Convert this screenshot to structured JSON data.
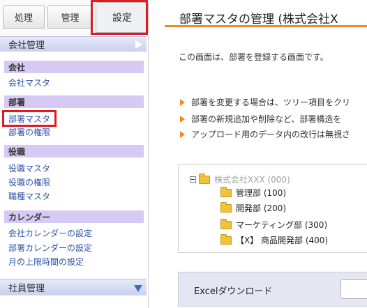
{
  "tabs": [
    {
      "label": "処理"
    },
    {
      "label": "管理"
    },
    {
      "label": "設定"
    }
  ],
  "sidebar": {
    "company_header": "会社管理",
    "employee_header": "社員管理",
    "sections": [
      {
        "label": "会社",
        "links": [
          "会社マスタ"
        ]
      },
      {
        "label": "部署",
        "links": [
          "部署マスタ",
          "部署の権限"
        ]
      },
      {
        "label": "役職",
        "links": [
          "役職マスタ",
          "役職の権限",
          "職種マスタ"
        ]
      },
      {
        "label": "カレンダー",
        "links": [
          "会社カレンダーの設定",
          "部署カレンダーの設定",
          "月の上限時間の設定"
        ]
      }
    ]
  },
  "main": {
    "title": "部署マスタの管理 (株式会社X",
    "description": "この画面は、部署を登録する画面です。",
    "notes": [
      "部署を変更する場合は、ツリー項目をクリ",
      "部署の新規追加や削除など、部署構造を",
      "アップロード用のデータ内の改行は無視さ"
    ],
    "tree": {
      "root": "株式会社XXX (000)",
      "children": [
        "管理部 (100)",
        "開発部 (200)",
        "マーケティング部 (300)",
        "【X】 商品開発部 (400)"
      ]
    },
    "excel_download_label": "Excelダウンロード"
  },
  "colors": {
    "accent_orange": "#f08a1c",
    "highlight_red": "#e01b24",
    "section_purple": "#d6c9f3",
    "link_blue": "#2b52a8"
  }
}
